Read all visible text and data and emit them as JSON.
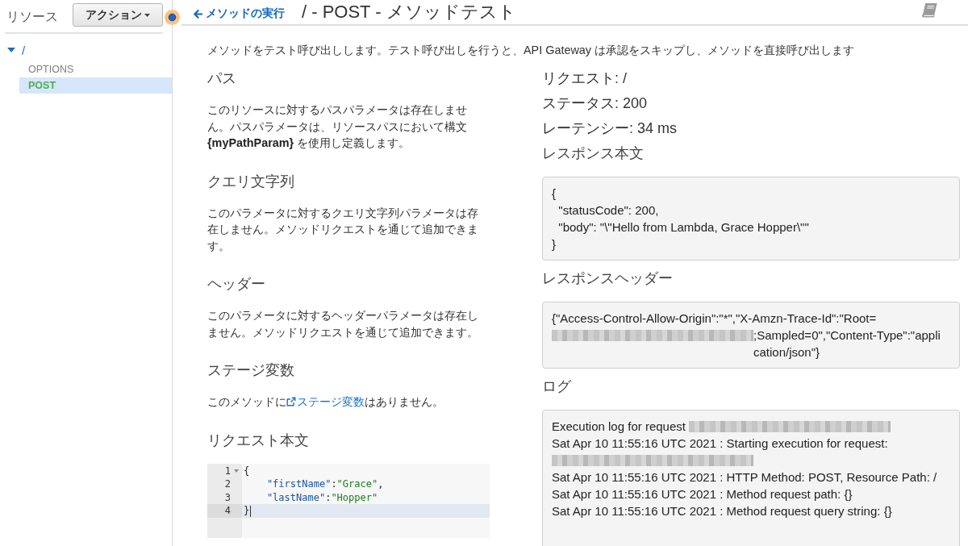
{
  "sidebar": {
    "label": "リソース",
    "action_button": "アクション",
    "tree": [
      {
        "label": "/",
        "expanded": true,
        "children": [
          {
            "label": "OPTIONS",
            "selected": false
          },
          {
            "label": "POST",
            "selected": true
          }
        ]
      }
    ]
  },
  "header": {
    "back_link": "メソッドの実行",
    "title": "/ - POST - メソッドテスト"
  },
  "description": "メソッドをテスト呼び出しします。テスト呼び出しを行うと、API Gateway は承認をスキップし、メソッドを直接呼び出します",
  "sections": [
    {
      "kind": "text",
      "heading": "パス",
      "text": "このリソースに対するパスパラメータは存在しません。パスパラメータは、リソースパスにおいて構文 **{myPathParam}** を使用し定義します。"
    },
    {
      "kind": "text",
      "heading": "クエリ文字列",
      "text": "このパラメータに対するクエリ文字列パラメータは存在しません。メソッドリクエストを通じて追加できます。"
    },
    {
      "kind": "text",
      "heading": "ヘッダー",
      "text": "このパラメータに対するヘッダーパラメータは存在しません。メソッドリクエストを通じて追加できます。"
    },
    {
      "kind": "link_text",
      "heading": "ステージ変数",
      "text_before": "このメソッドに",
      "link": "ステージ変数",
      "text_after": "はありません。"
    },
    {
      "kind": "editor",
      "heading": "リクエスト本文",
      "lines": [
        {
          "number": "1",
          "fold": true,
          "active": false,
          "tokens": [
            {
              "kind": "punct",
              "text": "{"
            }
          ]
        },
        {
          "number": "2",
          "fold": false,
          "active": false,
          "tokens": [
            {
              "kind": "key",
              "text": "    \"firstName\""
            },
            {
              "kind": "punct",
              "text": ":"
            },
            {
              "kind": "string",
              "text": "\"Grace\""
            },
            {
              "kind": "punct",
              "text": ","
            }
          ]
        },
        {
          "number": "3",
          "fold": false,
          "active": false,
          "tokens": [
            {
              "kind": "key",
              "text": "    \"lastName\""
            },
            {
              "kind": "punct",
              "text": ":"
            },
            {
              "kind": "string",
              "text": "\"Hopper\""
            }
          ]
        },
        {
          "number": "4",
          "fold": false,
          "active": true,
          "tokens": [
            {
              "kind": "punct",
              "text": "}"
            }
          ]
        }
      ]
    }
  ],
  "result": {
    "request": "リクエスト: /",
    "status": "ステータス: 200",
    "latency": "レーテンシー: 34 ms",
    "response_body": {
      "heading": "レスポンス本文",
      "lines": [
        "{",
        "  \"statusCode\": 200,",
        "  \"body\": \"\\\"Hello from Lambda, Grace Hopper\\\"\"",
        "}"
      ]
    },
    "response_headers": {
      "heading": "レスポンスヘッダー",
      "segments": [
        {
          "kind": "text",
          "text": "{\"Access-Control-Allow-Origin\":\"*\",\"X-Amzn-Trace-Id\":\"Root="
        },
        {
          "kind": "redacted"
        },
        {
          "kind": "text",
          "text": ";Sampled=0\",\"Content-Type\":\"application/json\"}"
        }
      ]
    },
    "logs": {
      "heading": "ログ",
      "entries": [
        {
          "segments": [
            {
              "kind": "text",
              "text": "Execution log for request "
            },
            {
              "kind": "redacted"
            }
          ]
        },
        {
          "segments": [
            {
              "kind": "text",
              "text": "Sat Apr 10 11:55:16 UTC 2021 : Starting execution for request: "
            },
            {
              "kind": "redacted"
            }
          ]
        },
        {
          "segments": [
            {
              "kind": "text",
              "text": "Sat Apr 10 11:55:16 UTC 2021 : HTTP Method: POST, Resource Path: /"
            }
          ]
        },
        {
          "segments": [
            {
              "kind": "text",
              "text": "Sat Apr 10 11:55:16 UTC 2021 : Method request path: {}"
            }
          ]
        },
        {
          "segments": [
            {
              "kind": "text",
              "text": "Sat Apr 10 11:55:16 UTC 2021 : Method request query string: {}"
            }
          ]
        }
      ]
    }
  }
}
